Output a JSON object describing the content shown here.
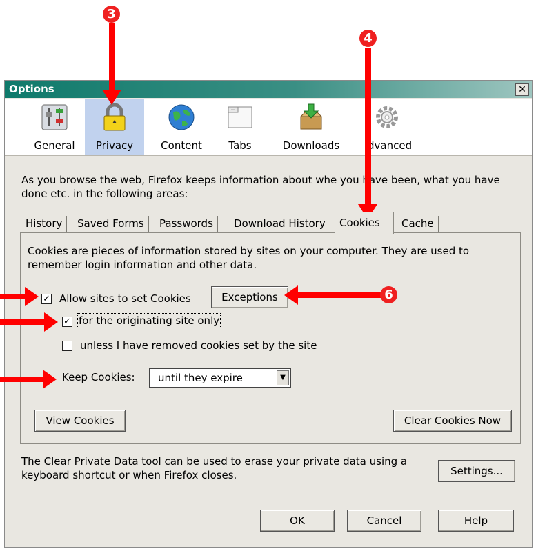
{
  "window": {
    "title": "Options",
    "close_label": "x"
  },
  "toolbar": {
    "items": [
      {
        "label": "General",
        "icon": "general-icon"
      },
      {
        "label": "Privacy",
        "icon": "privacy-lock-icon",
        "selected": true
      },
      {
        "label": "Content",
        "icon": "globe-icon"
      },
      {
        "label": "Tabs",
        "icon": "tabs-icon"
      },
      {
        "label": "Downloads",
        "icon": "downloads-box-icon"
      },
      {
        "label": "dvanced",
        "icon": "gear-icon"
      }
    ]
  },
  "privacy": {
    "description": "As you browse the web, Firefox keeps information about whe  you have been, what you have done etc. in the following areas:",
    "tabs": [
      "History",
      "Saved Forms",
      "Passwords",
      "Download History",
      "Cookies",
      "Cache"
    ],
    "active_tab": "Cookies"
  },
  "cookies": {
    "description": "Cookies are pieces of information stored by sites on your computer. They are used to remember login information and other data.",
    "allow_label": "Allow sites to set Cookies",
    "allow_checked": true,
    "exceptions_label": "Exceptions",
    "originating_label": "for the originating site only",
    "originating_checked": true,
    "unless_label": "unless I have removed cookies set by the site",
    "unless_checked": false,
    "keep_label": "Keep Cookies:",
    "keep_value": "until they expire",
    "view_label": "View Cookies",
    "clear_label": "Clear Cookies Now"
  },
  "private_data": {
    "text": "The Clear Private Data tool can be used to erase your private data using a keyboard shortcut or when Firefox closes.",
    "settings_label": "Settings..."
  },
  "footer": {
    "ok": "OK",
    "cancel": "Cancel",
    "help": "Help"
  },
  "annotations": {
    "badge_3": "3",
    "badge_4": "4",
    "badge_6": "6",
    "arrow_color": "#ff0000"
  },
  "colors": {
    "titlebar": "#0f7a6b",
    "dialog_bg": "#e9e7e1",
    "selected_toolbar": "#c1d2ee"
  }
}
